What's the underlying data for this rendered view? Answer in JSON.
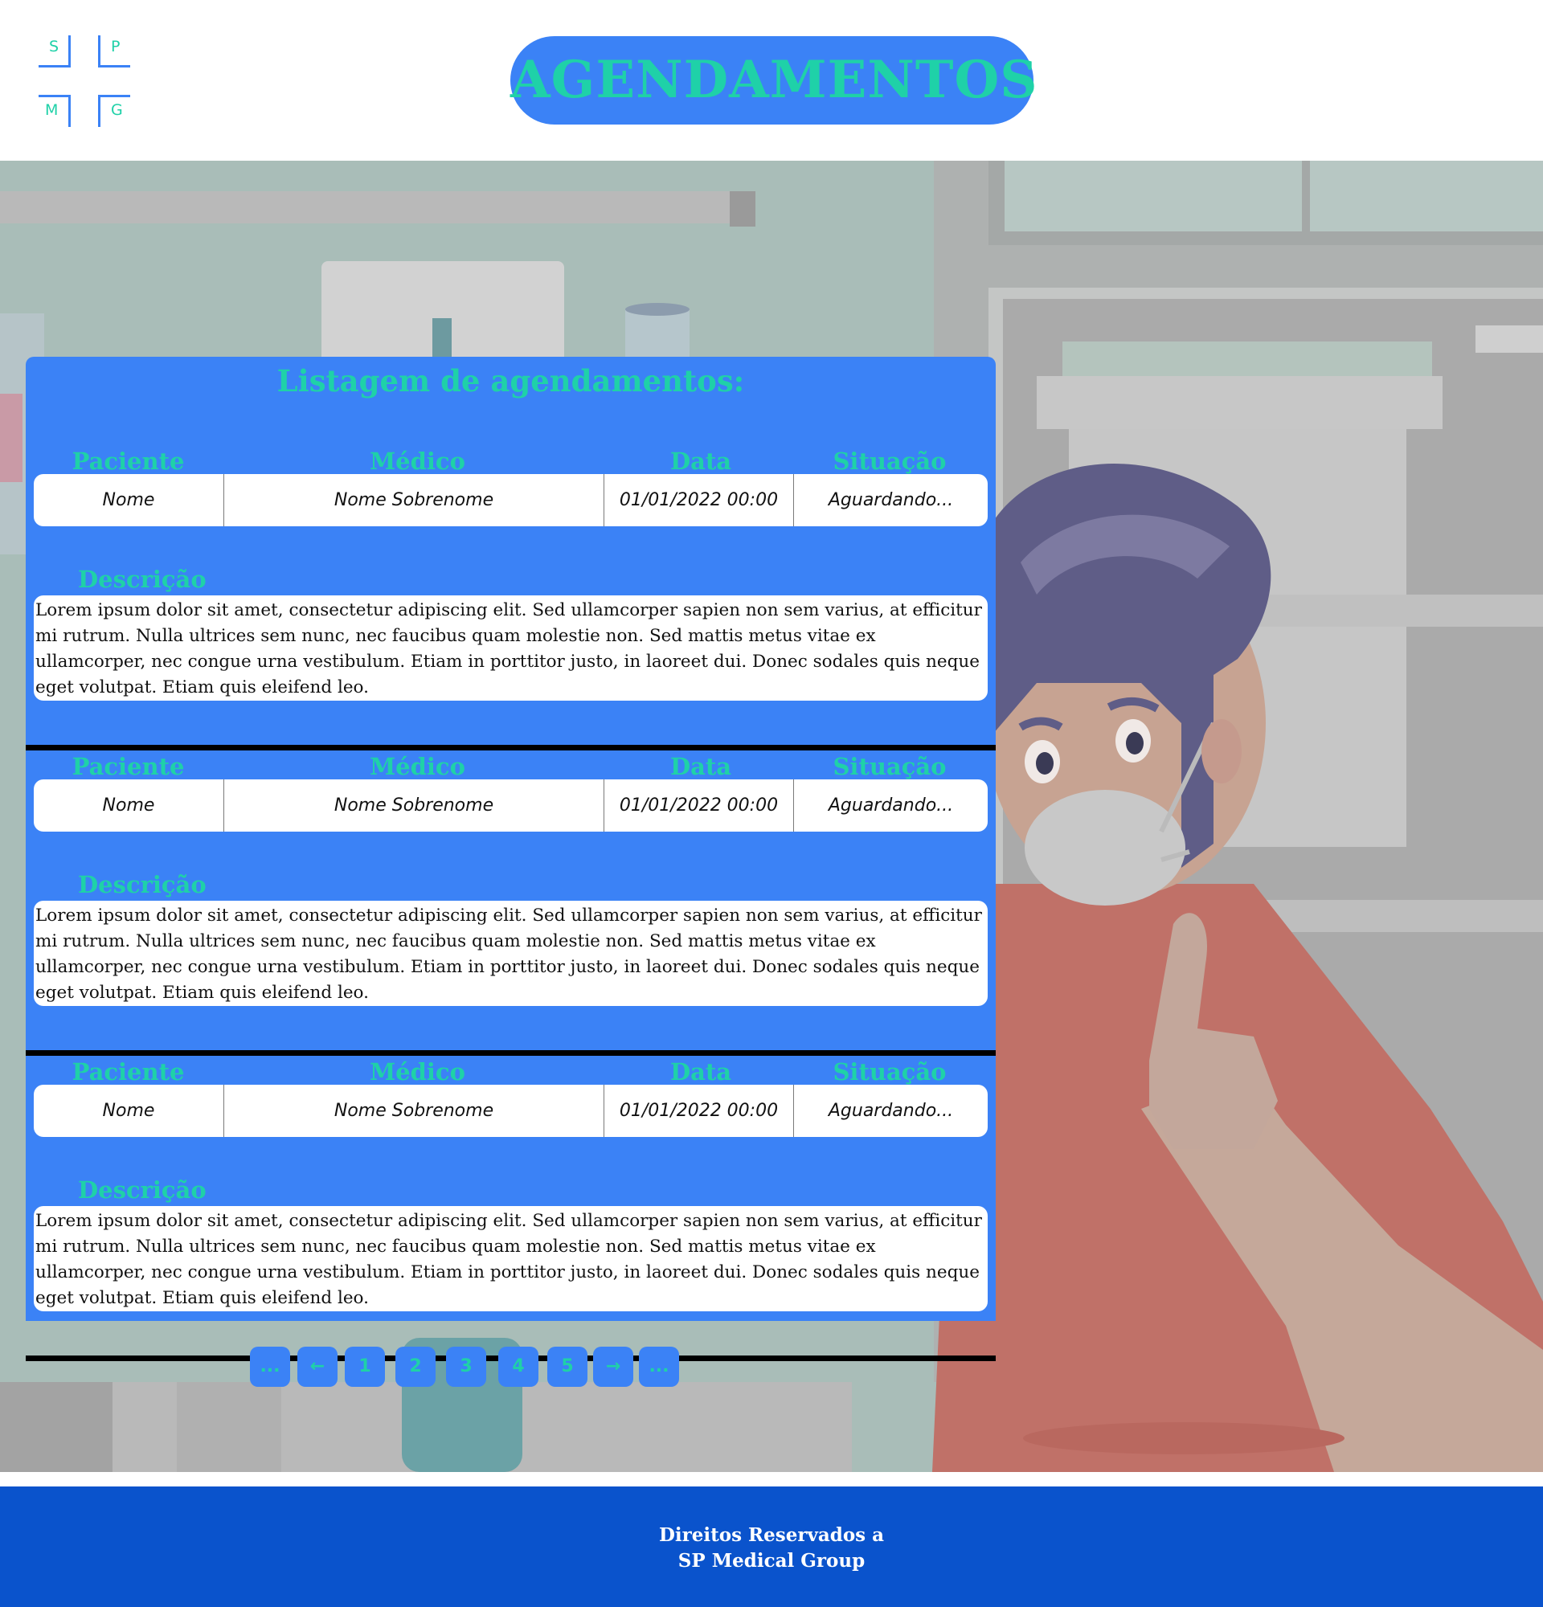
{
  "logo": {
    "letters": [
      "S",
      "P",
      "M",
      "G"
    ]
  },
  "header": {
    "title": "AGENDAMENTOS"
  },
  "listing": {
    "title": "Listagem de agendamentos:",
    "columns": [
      "Paciente",
      "Médico",
      "Data",
      "Situação"
    ],
    "description_label": "Descrição",
    "records": [
      {
        "paciente": "Nome",
        "medico": "Nome Sobrenome",
        "data": "01/01/2022 00:00",
        "situacao": "Aguardando...",
        "descricao": "Lorem ipsum dolor sit amet, consectetur adipiscing elit. Sed ullamcorper sapien non sem varius, at efficitur mi rutrum. Nulla ultrices sem nunc, nec faucibus quam molestie non. Sed mattis metus vitae ex ullamcorper, nec congue urna vestibulum. Etiam in porttitor justo, in laoreet dui. Donec sodales quis neque eget volutpat. Etiam quis eleifend leo."
      },
      {
        "paciente": "Nome",
        "medico": "Nome Sobrenome",
        "data": "01/01/2022 00:00",
        "situacao": "Aguardando...",
        "descricao": "Lorem ipsum dolor sit amet, consectetur adipiscing elit. Sed ullamcorper sapien non sem varius, at efficitur mi rutrum. Nulla ultrices sem nunc, nec faucibus quam molestie non. Sed mattis metus vitae ex ullamcorper, nec congue urna vestibulum. Etiam in porttitor justo, in laoreet dui. Donec sodales quis neque eget volutpat. Etiam quis eleifend leo."
      },
      {
        "paciente": "Nome",
        "medico": "Nome Sobrenome",
        "data": "01/01/2022 00:00",
        "situacao": "Aguardando...",
        "descricao": "Lorem ipsum dolor sit amet, consectetur adipiscing elit. Sed ullamcorper sapien non sem varius, at efficitur mi rutrum. Nulla ultrices sem nunc, nec faucibus quam molestie non. Sed mattis metus vitae ex ullamcorper, nec congue urna vestibulum. Etiam in porttitor justo, in laoreet dui. Donec sodales quis neque eget volutpat. Etiam quis eleifend leo."
      }
    ]
  },
  "pagination": {
    "first_ellipsis": "...",
    "prev": "←",
    "pages": [
      "1",
      "2",
      "3",
      "4",
      "5"
    ],
    "next": "→",
    "last_ellipsis": "..."
  },
  "footer": {
    "line1": "Direitos Reservados a",
    "line2": "SP Medical Group"
  },
  "colors": {
    "primary_blue": "#3b82f6",
    "accent_green": "#1fd1a8",
    "footer_blue": "#0a53cc",
    "separator": "#000000"
  },
  "icons": {
    "prev": "arrow-left-icon",
    "next": "arrow-right-icon"
  }
}
